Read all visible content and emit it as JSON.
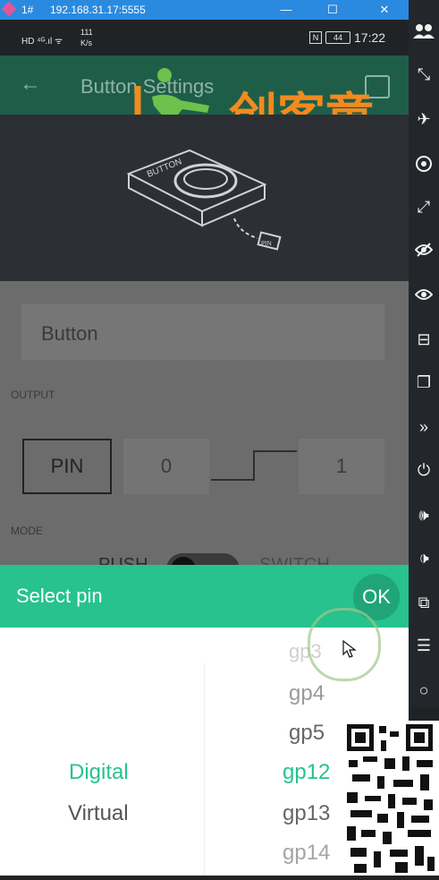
{
  "window": {
    "tab": "1#",
    "address": "192.168.31.17:5555",
    "minimize": "—",
    "maximize": "☐",
    "close": "✕"
  },
  "statusbar": {
    "left": "HD ⁴ᴳ.ıl ᯤ",
    "speed_value": "111",
    "speed_unit": "K/s",
    "nfc": "N",
    "battery": "44",
    "time": "17:22"
  },
  "appbar": {
    "back": "←",
    "title": "Button Settings"
  },
  "logo_text": "创客童",
  "hero": {
    "device_label": "BUTTON",
    "pin_tag": "PIN"
  },
  "form": {
    "name_value": "Button",
    "output_label": "OUTPUT",
    "pin_button": "PIN",
    "low_value": "0",
    "high_value": "1",
    "mode_label": "MODE",
    "push_label": "PUSH",
    "switch_label": "SWITCH"
  },
  "sheet": {
    "title": "Select pin",
    "ok": "OK"
  },
  "picker": {
    "types": [
      "Digital",
      "Virtual"
    ],
    "pins": [
      "gp3",
      "gp4",
      "gp5",
      "gp12",
      "gp13",
      "gp14"
    ],
    "selected_type": "Digital",
    "selected_pin": "gp12"
  },
  "toolbar": {
    "icons": [
      "users-icon",
      "fullscreen-exit-icon",
      "airplane-icon",
      "settings-dot-icon",
      "expand-icon",
      "eye-off-icon",
      "eye-icon",
      "minus-box-icon",
      "copy-icon",
      "chevrons-down-icon",
      "power-icon",
      "volume-up-icon",
      "volume-down-icon",
      "window-icon",
      "menu-icon",
      "circle-icon"
    ]
  },
  "colors": {
    "accent": "#27c28e",
    "appbar": "#1e5e49",
    "titlebar": "#2a8ae0",
    "logo_orange": "#f28a1f",
    "logo_green": "#6cc24a"
  }
}
